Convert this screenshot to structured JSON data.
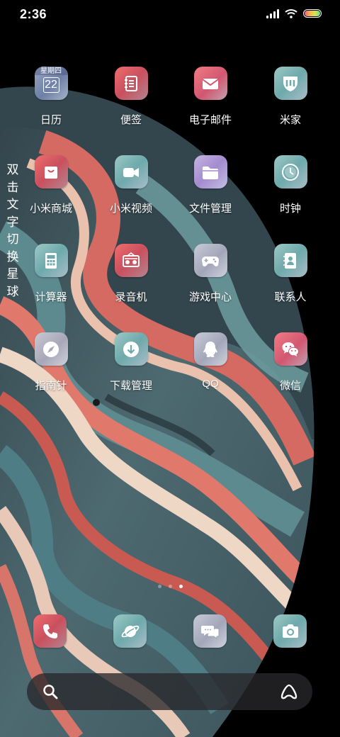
{
  "status_bar": {
    "time": "2:36"
  },
  "side_text": "双击文字切换星球",
  "apps": [
    {
      "label": "日历",
      "icon": "calendar-icon",
      "weekday": "星期四",
      "day": "22"
    },
    {
      "label": "便签",
      "icon": "notes-icon"
    },
    {
      "label": "电子邮件",
      "icon": "mail-icon"
    },
    {
      "label": "米家",
      "icon": "mijia-icon"
    },
    {
      "label": "小米商城",
      "icon": "shopping-bag-icon"
    },
    {
      "label": "小米视频",
      "icon": "video-camera-icon"
    },
    {
      "label": "文件管理",
      "icon": "folder-icon"
    },
    {
      "label": "时钟",
      "icon": "clock-icon"
    },
    {
      "label": "计算器",
      "icon": "calculator-icon"
    },
    {
      "label": "录音机",
      "icon": "radio-recorder-icon"
    },
    {
      "label": "游戏中心",
      "icon": "gamepad-icon"
    },
    {
      "label": "联系人",
      "icon": "contacts-book-icon"
    },
    {
      "label": "指南针",
      "icon": "compass-icon"
    },
    {
      "label": "下载管理",
      "icon": "download-icon"
    },
    {
      "label": "QQ",
      "icon": "qq-penguin-icon"
    },
    {
      "label": "微信",
      "icon": "wechat-icon"
    }
  ],
  "dock": [
    {
      "icon": "phone-icon"
    },
    {
      "icon": "browser-planet-icon"
    },
    {
      "icon": "messages-icon"
    },
    {
      "icon": "camera-icon"
    }
  ],
  "page_indicator": {
    "pages": 3,
    "current": 3
  },
  "search_bar": {
    "left_icon": "search-icon",
    "right_icon": "assistant-icon"
  }
}
